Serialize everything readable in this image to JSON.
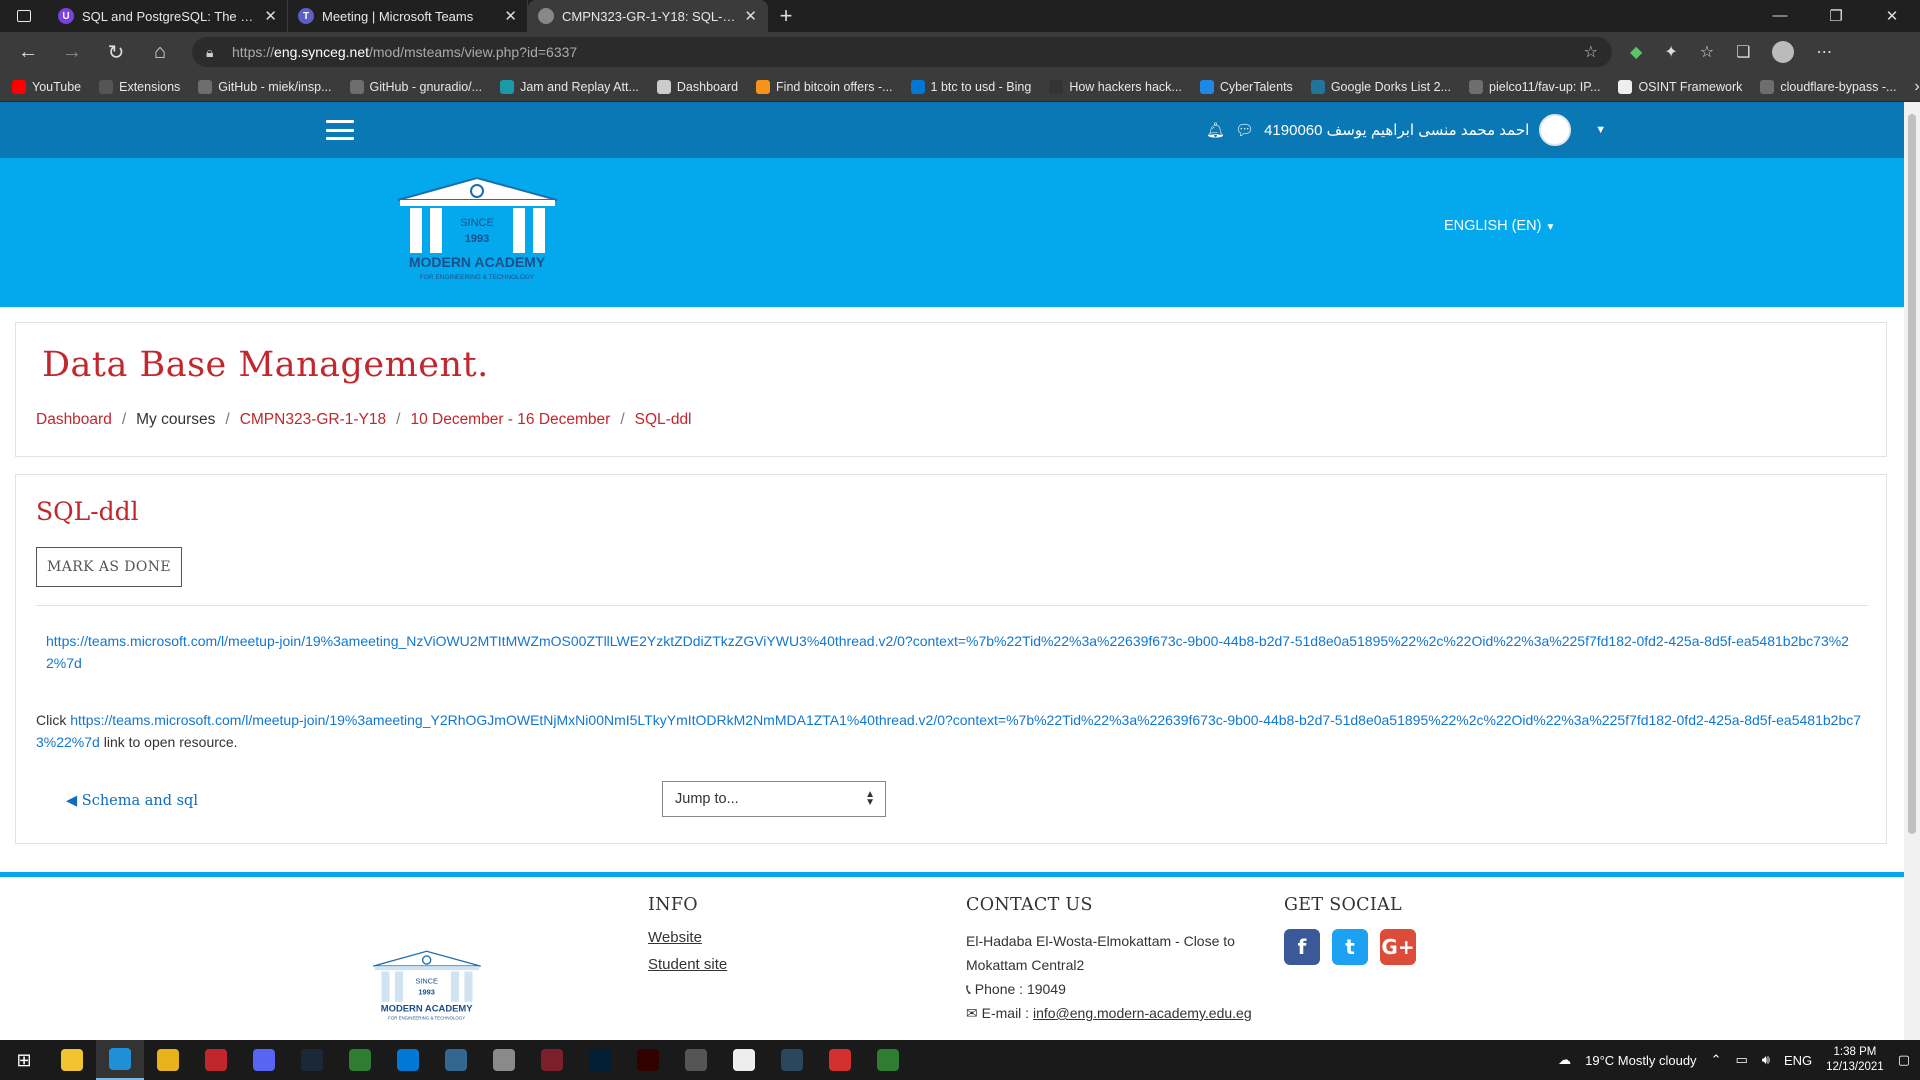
{
  "browser": {
    "tabs": [
      {
        "title": "SQL and PostgreSQL: The Compl",
        "favicon_color": "#7b3fe4",
        "favicon_glyph": "U",
        "active": false
      },
      {
        "title": "Meeting | Microsoft Teams",
        "favicon_color": "#5b5fc7",
        "favicon_glyph": "T",
        "active": false
      },
      {
        "title": "CMPN323-GR-1-Y18: SQL-ddl",
        "favicon_color": "#888888",
        "favicon_glyph": "",
        "active": true
      }
    ],
    "url_prefix": "https://",
    "url_host": "eng.synceg.net",
    "url_path": "/mod/msteams/view.php?id=6337",
    "bookmarks": [
      {
        "label": "YouTube",
        "color": "#ff0000"
      },
      {
        "label": "Extensions",
        "color": "#555555"
      },
      {
        "label": "GitHub - miek/insp...",
        "color": "#6e6e6e"
      },
      {
        "label": "GitHub - gnuradio/...",
        "color": "#6e6e6e"
      },
      {
        "label": "Jam and Replay Att...",
        "color": "#1b9aaa"
      },
      {
        "label": "Dashboard",
        "color": "#cccccc"
      },
      {
        "label": "Find bitcoin offers -...",
        "color": "#f7931a"
      },
      {
        "label": "1 btc to usd - Bing",
        "color": "#0078d4"
      },
      {
        "label": "How hackers hack...",
        "color": "#333333"
      },
      {
        "label": "CyberTalents",
        "color": "#1e88e5"
      },
      {
        "label": "Google Dorks List 2...",
        "color": "#21759b"
      },
      {
        "label": "pielco11/fav-up: IP...",
        "color": "#6e6e6e"
      },
      {
        "label": "OSINT Framework",
        "color": "#eeeeee"
      },
      {
        "label": "cloudflare-bypass -...",
        "color": "#6e6e6e"
      }
    ]
  },
  "site": {
    "user_name": "احمد محمد منسى ابراهيم يوسف 4190060",
    "language": "ENGLISH (EN)",
    "logo_text": {
      "since": "SINCE",
      "year": "1993",
      "name": "MODERN ACADEMY",
      "tag": "FOR ENGINEERING & TECHNOLOGY"
    },
    "accent": "#c1272d",
    "nav_color": "#0a78b4",
    "header_color": "#04a9ed"
  },
  "page": {
    "course_title": "Data Base Management.",
    "breadcrumb": [
      {
        "label": "Dashboard",
        "link": true
      },
      {
        "label": "My courses",
        "link": false
      },
      {
        "label": "CMPN323-GR-1-Y18",
        "link": true
      },
      {
        "label": "10 December - 16 December",
        "link": true
      },
      {
        "label": "SQL-ddl",
        "link": true
      }
    ],
    "activity_title": "SQL-ddl",
    "mark_done_label": "MARK AS DONE",
    "meeting_link": "https://teams.microsoft.com/l/meetup-join/19%3ameeting_NzViOWU2MTItMWZmOS00ZTllLWE2YzktZDdiZTkzZGViYWU3%40thread.v2/0?context=%7b%22Tid%22%3a%22639f673c-9b00-44b8-b2d7-51d8e0a51895%22%2c%22Oid%22%3a%225f7fd182-0fd2-425a-8d5f-ea5481b2bc73%22%7d",
    "click_prefix": "Click ",
    "click_link": "https://teams.microsoft.com/l/meetup-join/19%3ameeting_Y2RhOGJmOWEtNjMxNi00NmI5LTkyYmItODRkM2NmMDA1ZTA1%40thread.v2/0?context=%7b%22Tid%22%3a%22639f673c-9b00-44b8-b2d7-51d8e0a51895%22%2c%22Oid%22%3a%225f7fd182-0fd2-425a-8d5f-ea5481b2bc73%22%7d",
    "click_suffix": " link to open resource.",
    "prev_activity": "◀ Schema and sql",
    "jump_placeholder": "Jump to..."
  },
  "footer": {
    "info_heading": "INFO",
    "info_links": [
      "Website",
      "Student site"
    ],
    "contact_heading": "CONTACT US",
    "address": "El-Hadaba El-Wosta-Elmokattam - Close to Mokattam Central2",
    "phone": "Phone : 19049",
    "email_label": "E-mail : ",
    "email": "info@eng.modern-academy.edu.eg",
    "social_heading": "GET SOCIAL",
    "socials": [
      {
        "name": "facebook",
        "glyph": "f",
        "color": "#3b5998"
      },
      {
        "name": "twitter",
        "glyph": "t",
        "color": "#1da1f2"
      },
      {
        "name": "google-plus",
        "glyph": "G+",
        "color": "#dd4b39"
      }
    ]
  },
  "taskbar": {
    "apps": [
      {
        "name": "file-explorer",
        "color": "#f4c430"
      },
      {
        "name": "edge",
        "color": "#1f8fd6"
      },
      {
        "name": "chrome",
        "color": "#e8b31a"
      },
      {
        "name": "app-red",
        "color": "#c0262d"
      },
      {
        "name": "discord",
        "color": "#5865f2"
      },
      {
        "name": "steam",
        "color": "#1b2838"
      },
      {
        "name": "app-green",
        "color": "#2e7d32"
      },
      {
        "name": "vscode",
        "color": "#0078d4"
      },
      {
        "name": "pgadmin",
        "color": "#336791"
      },
      {
        "name": "database",
        "color": "#8a8a8a"
      },
      {
        "name": "app-maroon",
        "color": "#7a1f2b"
      },
      {
        "name": "photoshop",
        "color": "#001e36"
      },
      {
        "name": "illustrator",
        "color": "#330000"
      },
      {
        "name": "app-gray",
        "color": "#555555"
      },
      {
        "name": "window",
        "color": "#eeeeee"
      },
      {
        "name": "steam-2",
        "color": "#2a475e"
      },
      {
        "name": "app-flag",
        "color": "#d32f2f"
      },
      {
        "name": "app-git",
        "color": "#2e7d32"
      }
    ],
    "weather": "19°C  Mostly cloudy",
    "lang": "ENG",
    "time": "1:38 PM",
    "date": "12/13/2021"
  }
}
